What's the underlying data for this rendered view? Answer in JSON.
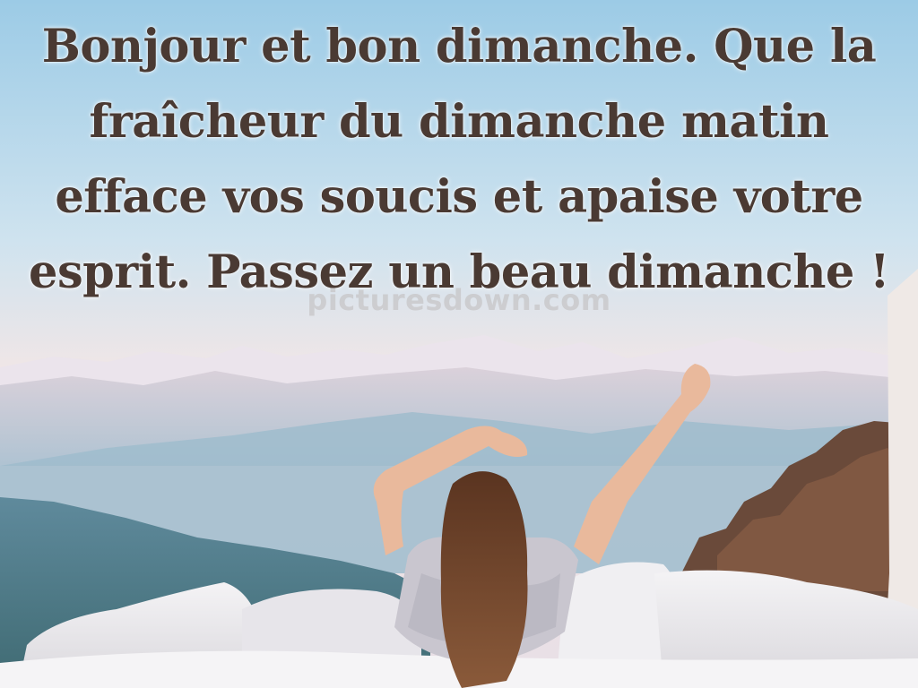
{
  "quote": {
    "lines": [
      "Bonjour et bon dimanche. Que la",
      "fraîcheur du dimanche matin",
      "efface vos soucis et apaise votre",
      "esprit. Passez un beau dimanche !"
    ]
  },
  "watermark": "picturesdown.com",
  "colors": {
    "text": "#4a3a33",
    "sky_top": "#9ccbe6",
    "sky_bottom": "#f2e6e6",
    "mountains": "#dcd4dc",
    "hills": "#8fb2c6",
    "bedding": "#ecebee",
    "hair": "#6b3f26",
    "tree": "#6a4a3a"
  }
}
